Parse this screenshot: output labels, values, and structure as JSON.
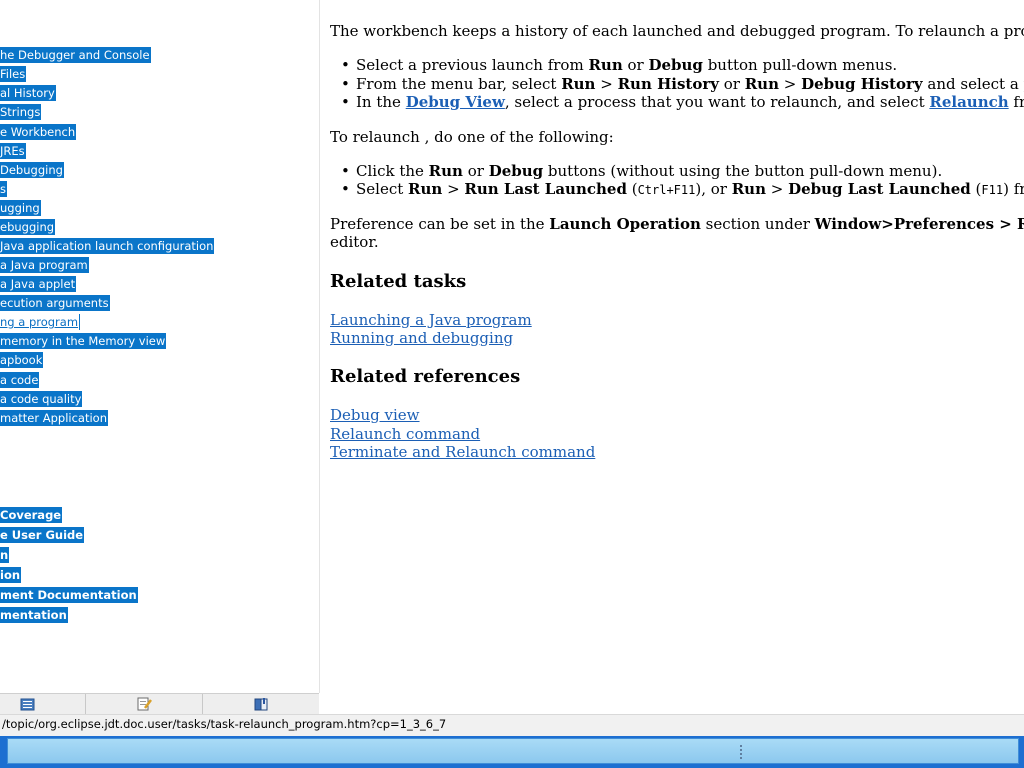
{
  "toc": {
    "items": [
      {
        "label": "he Debugger and Console",
        "bold": false,
        "current": false
      },
      {
        "label": "Files",
        "bold": false,
        "current": false
      },
      {
        "label": "al History",
        "bold": false,
        "current": false
      },
      {
        "label": "Strings",
        "bold": false,
        "current": false
      },
      {
        "label": "e Workbench",
        "bold": false,
        "current": false
      },
      {
        "label": "JREs",
        "bold": false,
        "current": false
      },
      {
        "label": "Debugging",
        "bold": false,
        "current": false
      },
      {
        "label": "s",
        "bold": false,
        "current": false
      },
      {
        "label": "ugging",
        "bold": false,
        "current": false
      },
      {
        "label": "ebugging",
        "bold": false,
        "current": false
      },
      {
        "label": "Java application launch configuration",
        "bold": false,
        "current": false
      },
      {
        "label": "a Java program",
        "bold": false,
        "current": false
      },
      {
        "label": "a Java applet",
        "bold": false,
        "current": false
      },
      {
        "label": "ecution arguments",
        "bold": false,
        "current": false
      },
      {
        "label": "ng a program",
        "bold": false,
        "current": true
      },
      {
        "label": "memory in the Memory view",
        "bold": false,
        "current": false
      },
      {
        "label": "apbook",
        "bold": false,
        "current": false
      },
      {
        "label": "a code",
        "bold": false,
        "current": false
      },
      {
        "label": "a code quality",
        "bold": false,
        "current": false
      },
      {
        "label": "matter Application",
        "bold": false,
        "current": false
      },
      {
        "label": "Coverage",
        "bold": true,
        "current": false
      },
      {
        "label": "e User Guide",
        "bold": true,
        "current": false
      },
      {
        "label": "n",
        "bold": true,
        "current": false
      },
      {
        "label": "ion",
        "bold": true,
        "current": false
      },
      {
        "label": "ment Documentation",
        "bold": true,
        "current": false
      },
      {
        "label": "mentation",
        "bold": true,
        "current": false
      }
    ],
    "tabs": [
      {
        "icon": "contents-icon"
      },
      {
        "icon": "search-results-icon"
      },
      {
        "icon": "bookmarks-icon"
      }
    ]
  },
  "content": {
    "intro": "The workbench keeps a history of each launched and debugged program. To relaunch a program, do one of t",
    "list1": [
      {
        "pre": "Select a previous launch from ",
        "b1": "Run",
        "mid": " or ",
        "b2": "Debug",
        "post": " button pull-down menus."
      },
      {
        "pre": "From the menu bar, select ",
        "b1": "Run",
        "gt1": " > ",
        "b2": "Run History",
        "or": " or ",
        "b3": "Run",
        "gt2": " > ",
        "b4": "Debug History",
        "post": " and select a previous launch"
      },
      {
        "pre": "In the ",
        "link1": "Debug View",
        "mid": ", select a process that you want to relaunch, and select ",
        "link2": "Relaunch",
        "post": " from the process's"
      }
    ],
    "relaunch_intro": "To relaunch , do one of the following:",
    "list2": [
      {
        "pre": "Click the ",
        "b1": "Run",
        "mid": " or ",
        "b2": "Debug",
        "post": " buttons (without using the button pull-down menu)."
      },
      {
        "pre": "Select ",
        "b1": "Run",
        "gt1": " > ",
        "b2": "Run Last Launched",
        "k1": "Ctrl+F11",
        "mid": "), or ",
        "b3": "Run",
        "gt2": " > ",
        "b4": "Debug Last Launched",
        "k2": "F11",
        "post": ") from the wor"
      }
    ],
    "pref_pre": "Preference can be set in the ",
    "pref_b1": "Launch Operation",
    "pref_mid": " section under ",
    "pref_b2": "Window>Preferences > Run/Debug > Laun",
    "pref_line2": "editor.",
    "related_tasks_heading": "Related tasks",
    "related_tasks": [
      "Launching a Java program",
      "Running and debugging"
    ],
    "related_refs_heading": "Related references",
    "related_refs": [
      "Debug view",
      "Relaunch command",
      "Terminate and Relaunch command"
    ]
  },
  "status": {
    "url": "/topic/org.eclipse.jdt.doc.user/tasks/task-relaunch_program.htm?cp=1_3_6_7"
  },
  "colors": {
    "selection": "#0a75c9",
    "link": "#1c5fb5",
    "taskbar": "#1d6fd1"
  }
}
